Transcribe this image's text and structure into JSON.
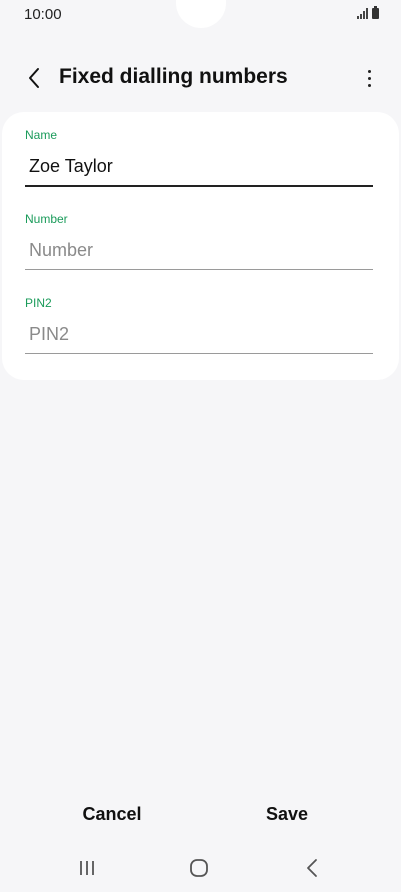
{
  "status_bar": {
    "time": "10:00",
    "icons": [
      "signal-icon",
      "battery-icon"
    ]
  },
  "header": {
    "title": "Fixed dialling numbers",
    "back_icon": "chevron-left-icon",
    "more_icon": "more-vertical-icon"
  },
  "form": {
    "name": {
      "label": "Name",
      "value": "Zoe Taylor",
      "placeholder": "Name"
    },
    "number": {
      "label": "Number",
      "value": "",
      "placeholder": "Number"
    },
    "pin2": {
      "label": "PIN2",
      "value": "",
      "placeholder": "PIN2"
    }
  },
  "actions": {
    "cancel_label": "Cancel",
    "save_label": "Save"
  },
  "nav_bar": {
    "icons": [
      "recent-apps-icon",
      "home-icon",
      "back-icon"
    ]
  },
  "colors": {
    "accent": "#1a9b5a",
    "background": "#f6f6f8",
    "card": "#ffffff"
  }
}
